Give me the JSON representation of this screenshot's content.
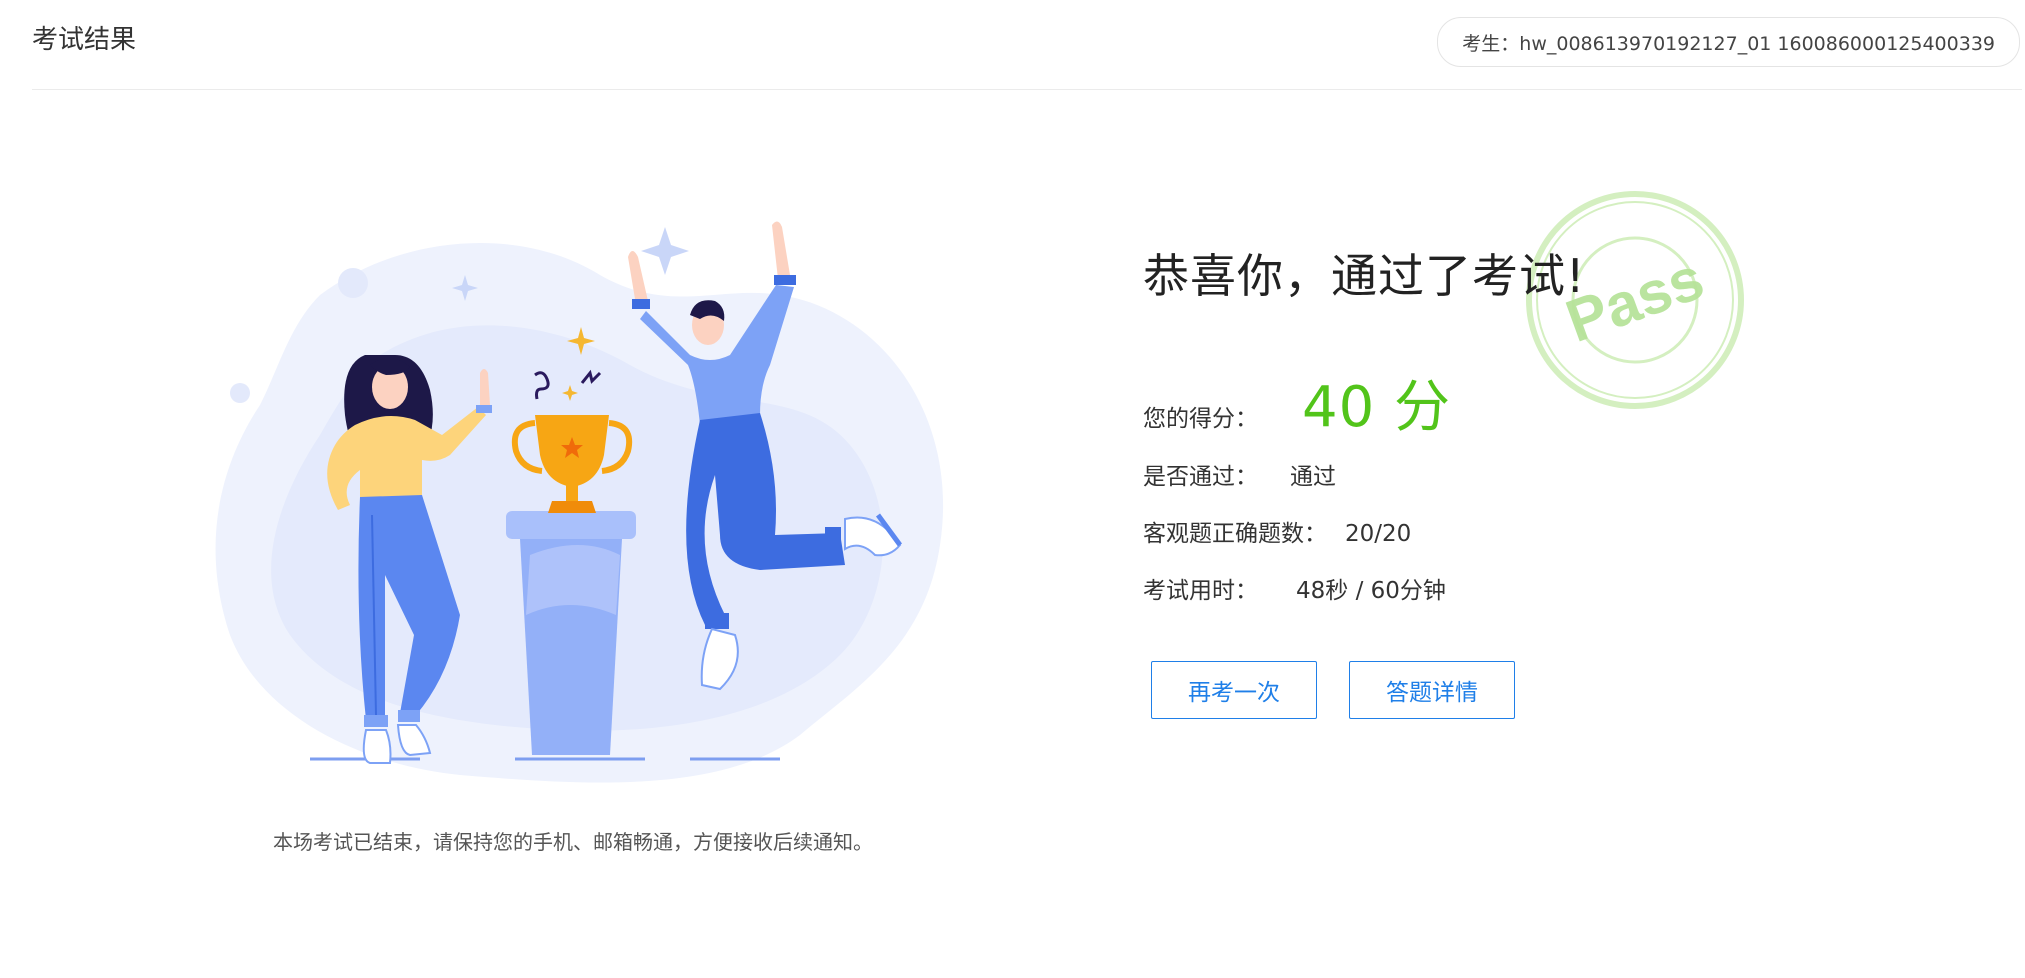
{
  "header": {
    "title": "考试结果",
    "candidate": "考生：hw_008613970192127_01 160086000125400339"
  },
  "illustration": {
    "notice": "本场考试已结束，请保持您的手机、邮箱畅通，方便接收后续通知。"
  },
  "result": {
    "headline": "恭喜你，通过了考试!",
    "stamp_text": "Pass",
    "score_label": "您的得分：",
    "score_value": "40 分",
    "pass_label": "是否通过：",
    "pass_value": "通过",
    "objective_label": "客观题正确题数：",
    "objective_value": "20/20",
    "time_label": "考试用时：",
    "time_value": "48秒 / 60分钟"
  },
  "actions": {
    "retry_label": "再考一次",
    "detail_label": "答题详情"
  },
  "colors": {
    "score": "#52c41a",
    "button": "#1f7fe8",
    "stamp": "#b7e39a"
  }
}
